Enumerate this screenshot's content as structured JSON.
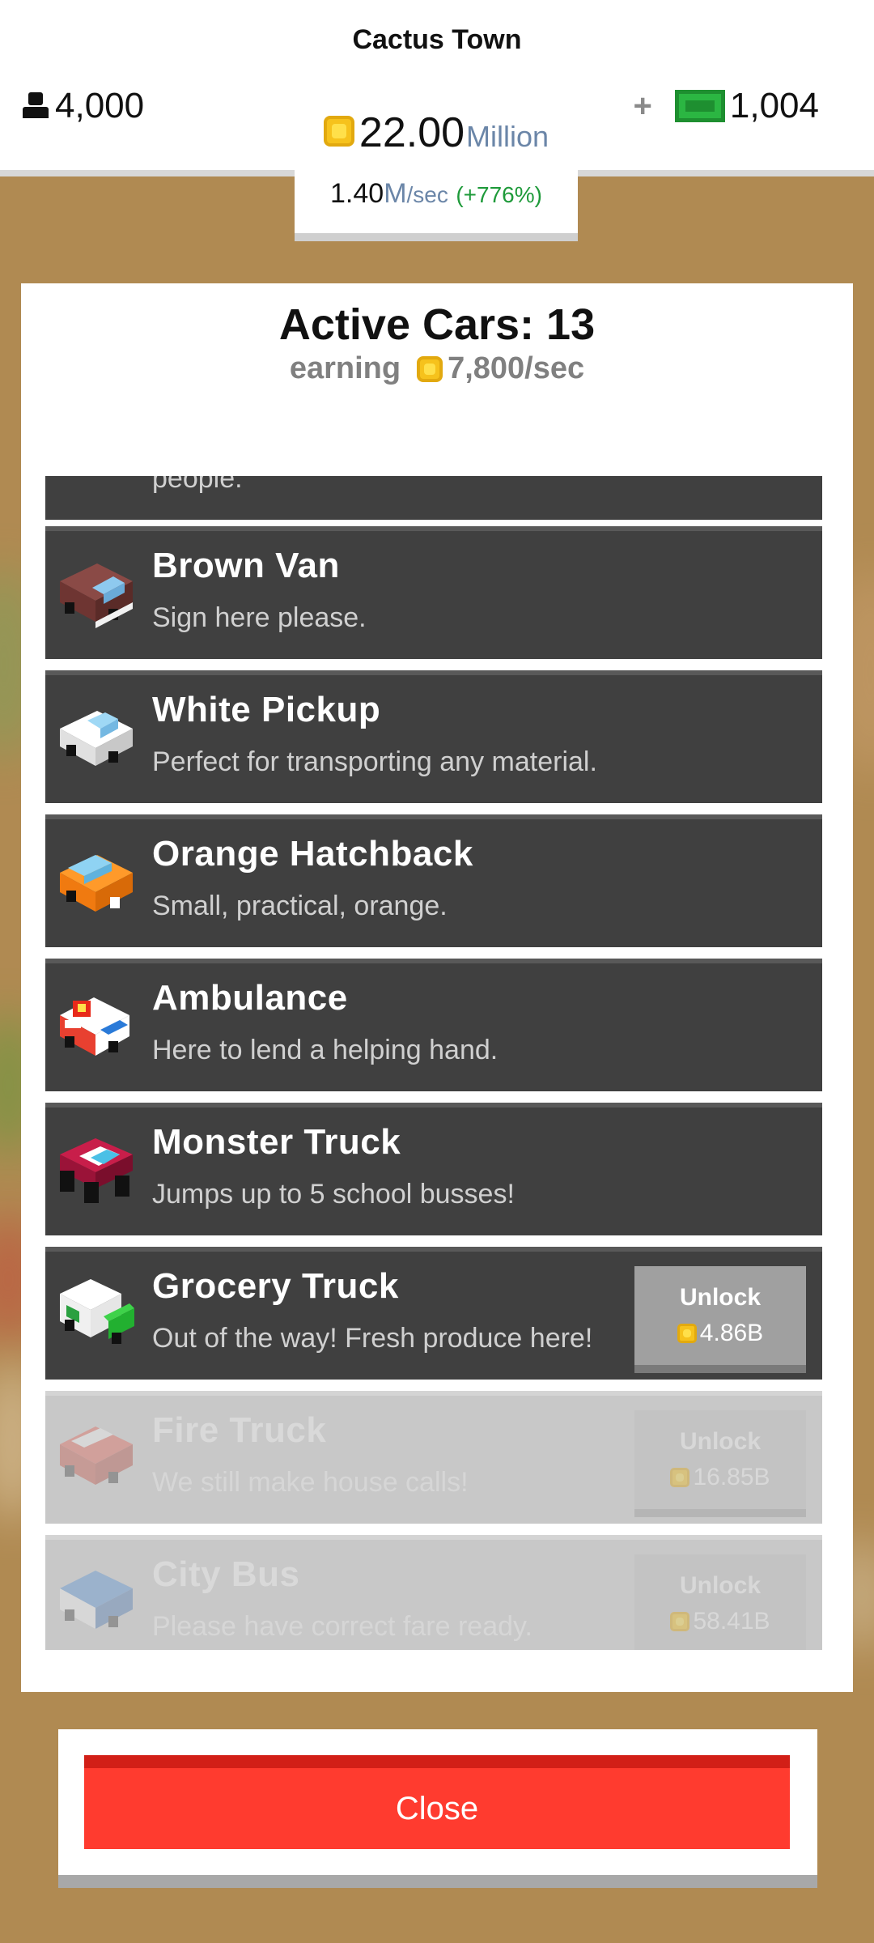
{
  "header": {
    "town_name": "Cactus Town",
    "population": "4,000",
    "money_value": "22.00",
    "money_unit": "Million",
    "rate_value": "1.40",
    "rate_unit": "M",
    "rate_per": "/sec",
    "rate_boost": "(+776%)",
    "plus_label": "+",
    "cash": "1,004"
  },
  "panel": {
    "title": "Active Cars: 13",
    "earning_label": "earning",
    "earning_value": "7,800/sec"
  },
  "cars": [
    {
      "name": "",
      "desc": "people."
    },
    {
      "name": "Brown Van",
      "desc": "Sign here please.",
      "icon": "brown-van-icon"
    },
    {
      "name": "White Pickup",
      "desc": "Perfect for transporting any material.",
      "icon": "white-pickup-icon"
    },
    {
      "name": "Orange Hatchback",
      "desc": "Small, practical, orange.",
      "icon": "orange-hatchback-icon"
    },
    {
      "name": "Ambulance",
      "desc": "Here to lend a helping hand.",
      "icon": "ambulance-icon"
    },
    {
      "name": "Monster Truck",
      "desc": "Jumps up to 5 school busses!",
      "icon": "monster-truck-icon"
    },
    {
      "name": "Grocery Truck",
      "desc": "Out of the way! Fresh produce here!",
      "icon": "grocery-truck-icon",
      "unlock_label": "Unlock",
      "cost": "4.86B"
    },
    {
      "name": "Fire Truck",
      "desc": "We still make house calls!",
      "icon": "fire-truck-icon",
      "unlock_label": "Unlock",
      "cost": "16.85B"
    },
    {
      "name": "City Bus",
      "desc": "Please have correct fare ready.",
      "icon": "city-bus-icon",
      "unlock_label": "Unlock",
      "cost": "58.41B"
    }
  ],
  "close_label": "Close"
}
